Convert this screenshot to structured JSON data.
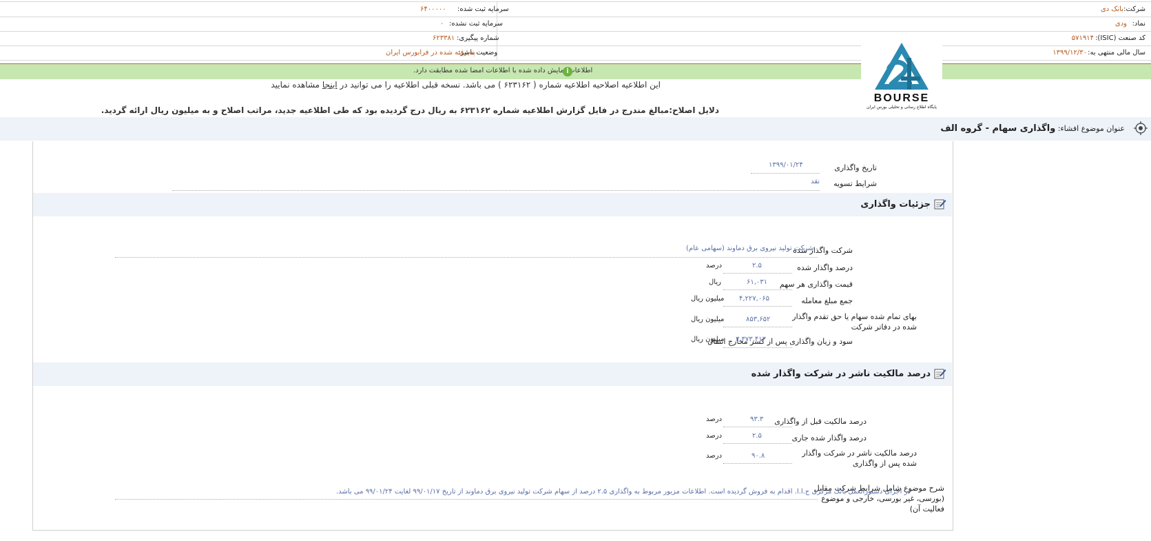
{
  "header": {
    "right": [
      {
        "label": "شرکت:",
        "value": "بانک دی"
      },
      {
        "label": "نماد:",
        "value": "ودی"
      },
      {
        "label": "کد صنعت (ISIC):",
        "value": "۵۷۱۹۱۴"
      },
      {
        "label": "سال مالی منتهی به:",
        "value": "۱۳۹۹/۱۲/۳۰"
      }
    ],
    "left": [
      {
        "label": "سرمایه ثبت شده:",
        "value": "۶۴۰۰۰۰۰"
      },
      {
        "label": "سرمایه ثبت نشده:",
        "value": "۰"
      },
      {
        "label": "شماره پیگیری:",
        "value": "۶۲۳۳۸۱"
      },
      {
        "label": "وضعیت ناشر:",
        "value": "پذیرفته شده در فرابورس ایران"
      }
    ]
  },
  "banner": {
    "message": "اطلاعات نمایش داده شده با اطلاعات امضا شده مطابقت دارد.",
    "icon": "info-icon",
    "color": "#c6e7b0"
  },
  "logo": {
    "text": "BOURSE",
    "subtitle": "پایگاه اطلاع رسانی و تحلیلی بورس ایران"
  },
  "notice": {
    "line1_pre": "این اطلاعیه اصلاحیه اطلاعیه شماره ( ۶۲۳۱۶۲ ) می باشد. نسخه قبلی اطلاعیه را می توانید در",
    "link": "اینجا",
    "line1_post": "مشاهده نمایید",
    "line2": "دلایل اصلاح:مبالغ مندرج در فایل گزارش اطلاعیه شماره ۶۲۳۱۶۲ به ریال درج گردیده بود که طی اطلاعیه جدید، مراتب اصلاح و به میلیون ریال ارائه گردید."
  },
  "subject": {
    "label": "عنوان موضوع افشاء:",
    "title": "واگذاری سهام - گروه الف"
  },
  "top_fields": [
    {
      "label": "تاریخ واگذاری",
      "value": "۱۳۹۹/۰۱/۲۴"
    },
    {
      "label": "شرایط تسویه",
      "value": "نقد"
    }
  ],
  "section1": {
    "title": "جزئیات واگذاری",
    "rows": [
      {
        "label": "شرکت واگذار شده",
        "value": "شرکت تولید نیروی برق دماوند (سهامی عام)",
        "unit": ""
      },
      {
        "label": "درصد واگذار شده",
        "value": "۲.۵",
        "unit": "درصد"
      },
      {
        "label": "قیمت واگذاری هر سهم",
        "value": "۶۱,۰۳۱",
        "unit": "ریال"
      },
      {
        "label": "جمع مبلغ معامله",
        "value": "۴,۲۲۷,۰۶۵",
        "unit": "میلیون ریال"
      },
      {
        "label": "بهای تمام شده سهام یا حق تقدم واگذار شده در دفاتر شرکت",
        "value": "۸۵۳,۶۵۲",
        "unit": "میلیون ریال"
      },
      {
        "label": "سود و زیان واگذاری پس از کسر مخارج انتقال",
        "value": "۳,۳۷۳,۴۱۳",
        "unit": "میلیون ریال"
      }
    ]
  },
  "section2": {
    "title": "درصد مالکیت ناشر در شرکت واگذار شده",
    "rows": [
      {
        "label": "درصد مالکیت قبل از واگذاری",
        "value": "۹۳.۳",
        "unit": "درصد"
      },
      {
        "label": "درصد واگذار شده جاری",
        "value": "۲.۵",
        "unit": "درصد"
      },
      {
        "label": "درصد مالکیت ناشر در شرکت واگذار شده پس از واگذاری",
        "value": "۹۰.۸",
        "unit": "درصد"
      }
    ],
    "desc_label": "شرح موضوع شامل شرایط شرکت مقابل (بورسی، غیر بورسی، خارجی و موضوع فعالیت آن)",
    "desc_value": "در اجرای دستورالعمل بانک مرکزی ج.ا.ا. اقدام به فروش گردیده است. اطلاعات مزبور مربوط به واگذاری ۲.۵ درصد از سهام شرکت تولید نیروی برق دماوند از تاریخ ۹۹/۰۱/۱۷ لغایت ۹۹/۰۱/۲۴ می باشد."
  }
}
